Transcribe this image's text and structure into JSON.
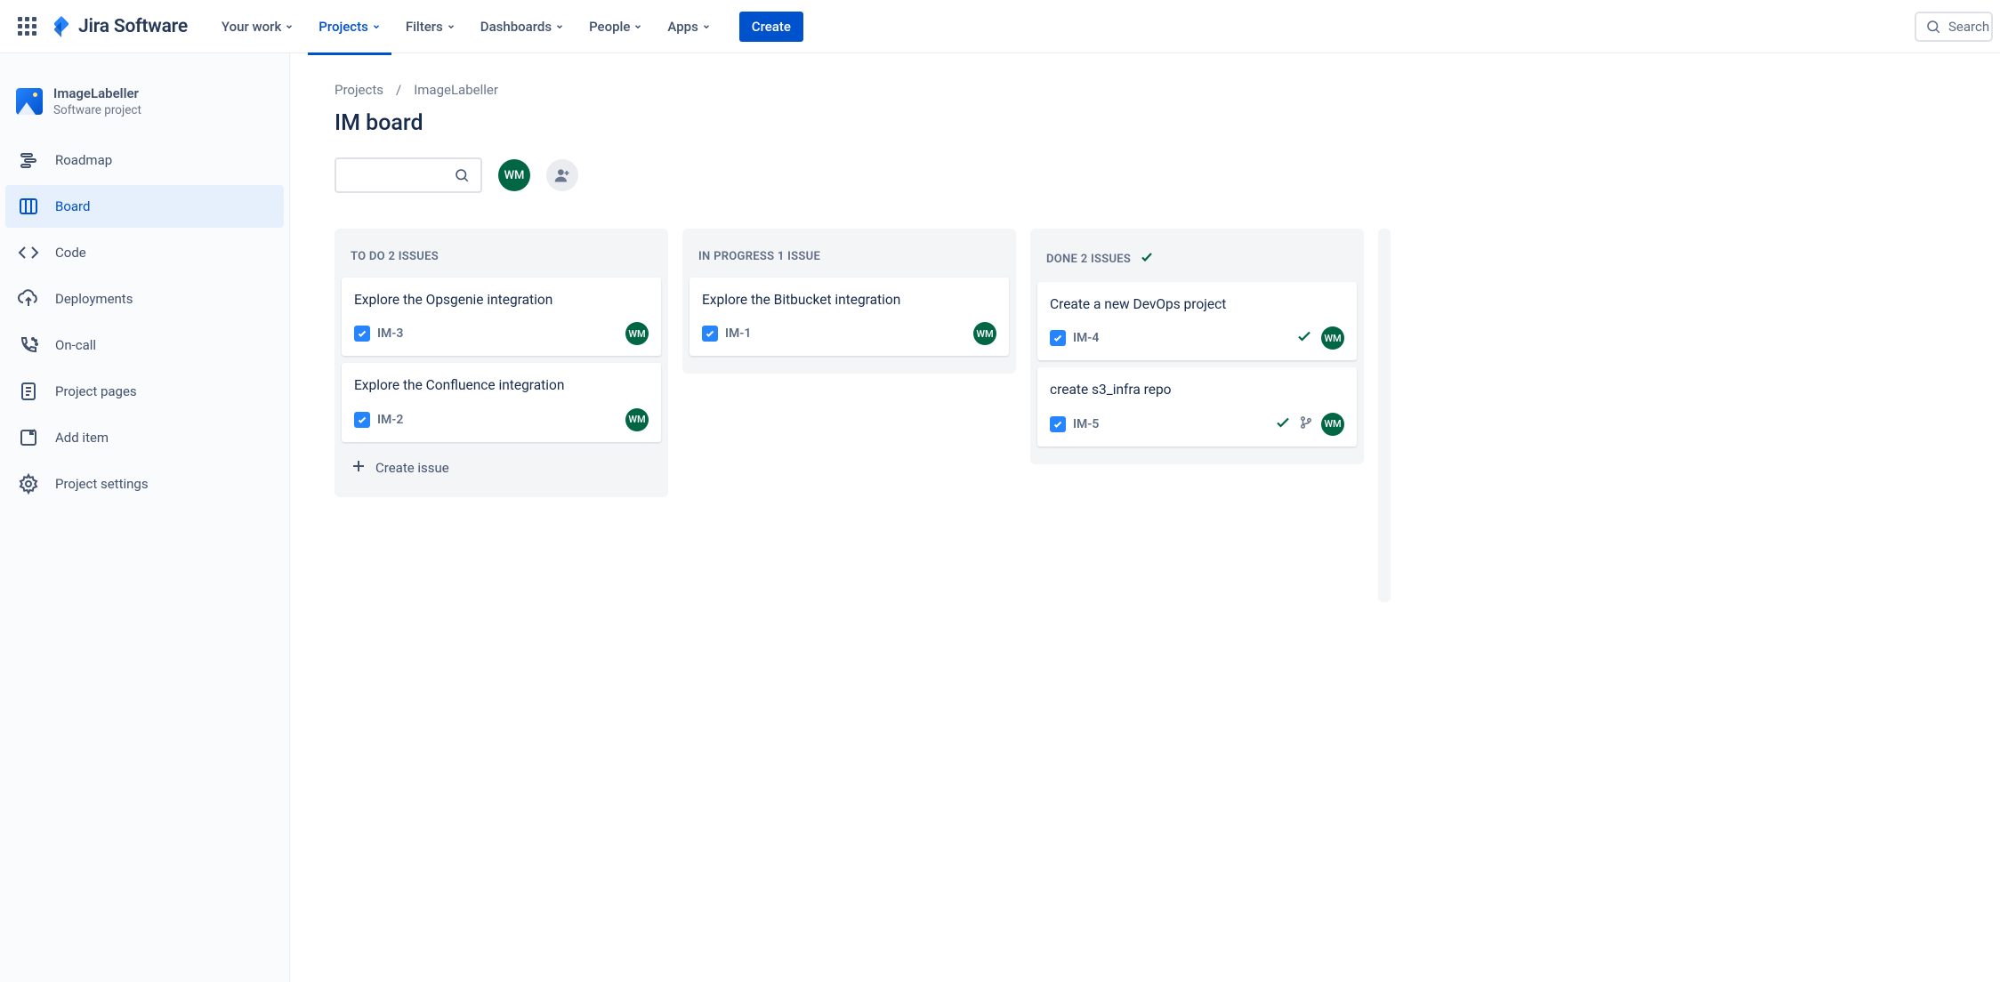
{
  "nav": {
    "logo_text": "Jira Software",
    "items": [
      "Your work",
      "Projects",
      "Filters",
      "Dashboards",
      "People",
      "Apps"
    ],
    "active_index": 1,
    "create": "Create",
    "search_placeholder": "Search"
  },
  "sidebar": {
    "project_name": "ImageLabeller",
    "project_type": "Software project",
    "items": [
      {
        "label": "Roadmap",
        "icon": "roadmap"
      },
      {
        "label": "Board",
        "icon": "board"
      },
      {
        "label": "Code",
        "icon": "code"
      },
      {
        "label": "Deployments",
        "icon": "deployments"
      },
      {
        "label": "On-call",
        "icon": "oncall"
      },
      {
        "label": "Project pages",
        "icon": "pages"
      },
      {
        "label": "Add item",
        "icon": "add"
      },
      {
        "label": "Project settings",
        "icon": "settings"
      }
    ],
    "active_index": 1
  },
  "breadcrumb": [
    "Projects",
    "ImageLabeller"
  ],
  "page_title": "IM board",
  "user_initials": "WM",
  "columns": [
    {
      "title": "TO DO",
      "count_label": "2 ISSUES",
      "done_badge": false,
      "show_create": true,
      "cards": [
        {
          "title": "Explore the Opsgenie integration",
          "key": "IM-3",
          "assignee": "WM",
          "done": false,
          "branch": false
        },
        {
          "title": "Explore the Confluence integration",
          "key": "IM-2",
          "assignee": "WM",
          "done": false,
          "branch": false
        }
      ]
    },
    {
      "title": "IN PROGRESS",
      "count_label": "1 ISSUE",
      "done_badge": false,
      "show_create": false,
      "cards": [
        {
          "title": "Explore the Bitbucket integration",
          "key": "IM-1",
          "assignee": "WM",
          "done": false,
          "branch": false
        }
      ]
    },
    {
      "title": "DONE",
      "count_label": "2 ISSUES",
      "done_badge": true,
      "show_create": false,
      "cards": [
        {
          "title": "Create a new DevOps project",
          "key": "IM-4",
          "assignee": "WM",
          "done": true,
          "branch": false
        },
        {
          "title": "create s3_infra repo",
          "key": "IM-5",
          "assignee": "WM",
          "done": true,
          "branch": true
        }
      ]
    }
  ],
  "create_issue_label": "Create issue"
}
